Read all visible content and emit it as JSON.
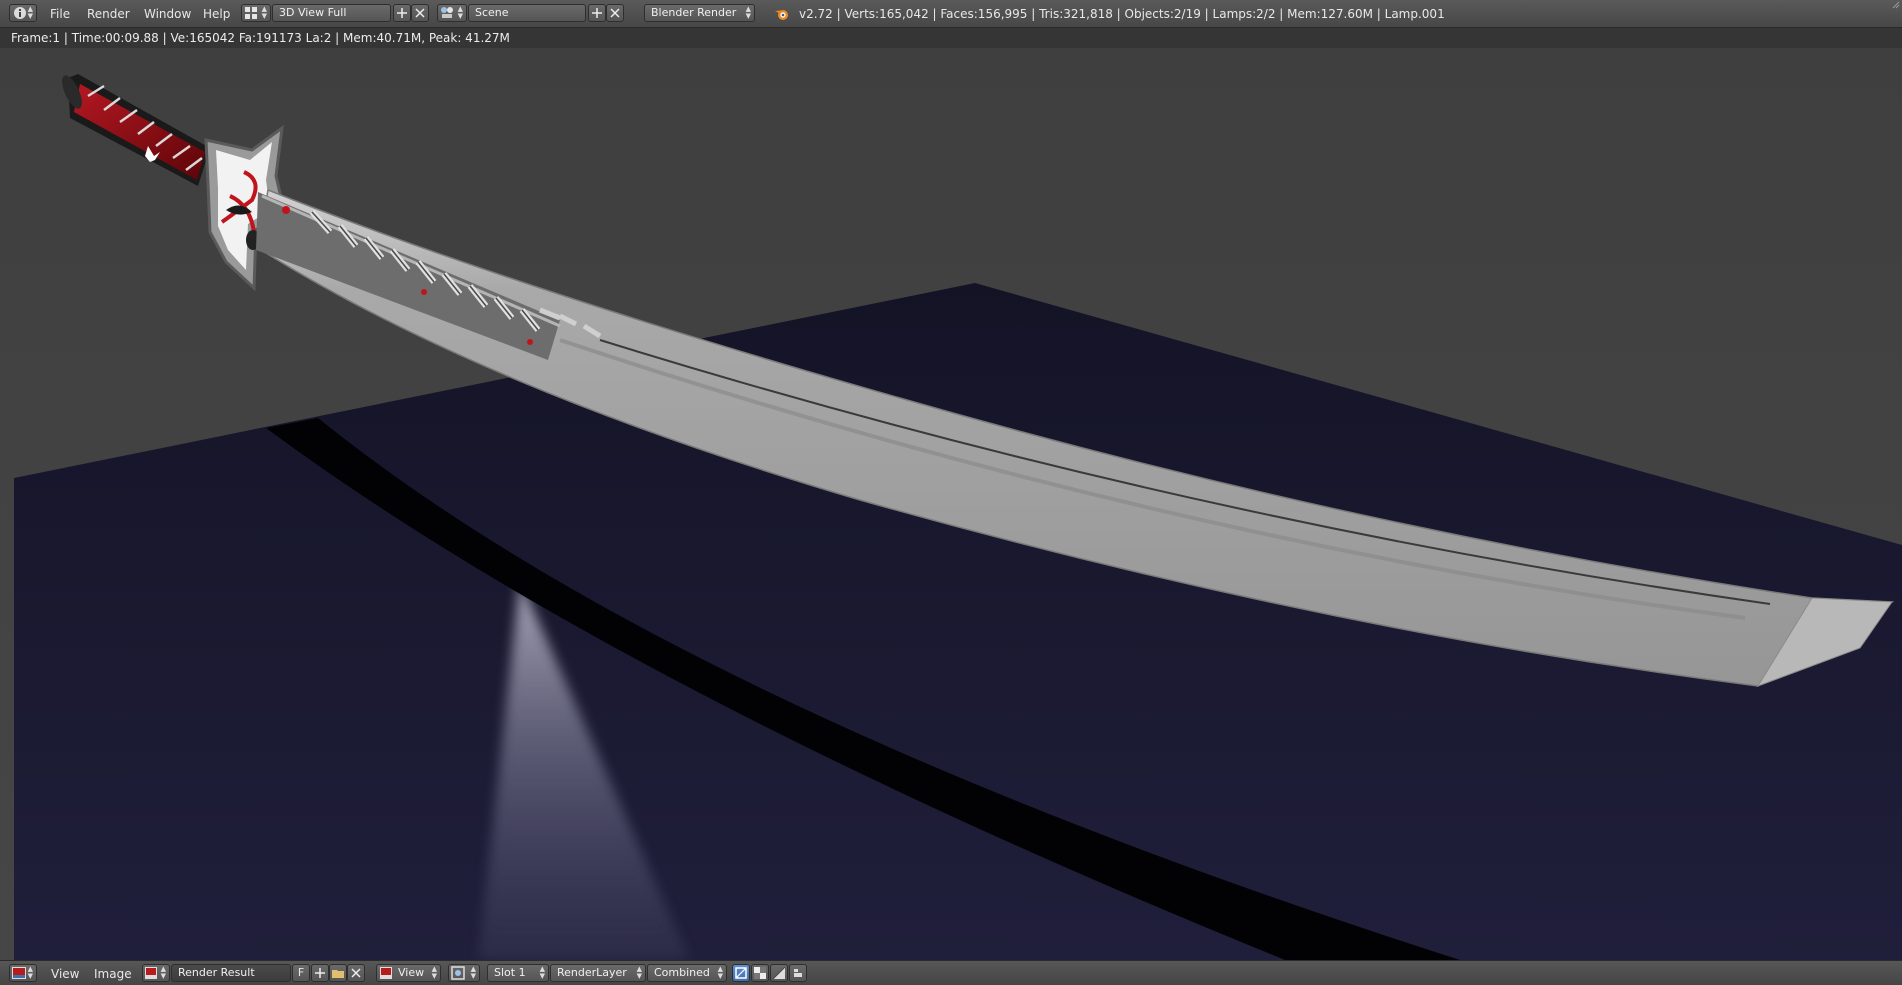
{
  "top_bar": {
    "menus": [
      "File",
      "Render",
      "Window",
      "Help"
    ],
    "screen_layout": "3D View Full",
    "scene": "Scene",
    "render_engine": "Blender Render",
    "stats": "v2.72 | Verts:165,042 | Faces:156,995 | Tris:321,818 | Objects:2/19 | Lamps:2/2 | Mem:127.60M | Lamp.001"
  },
  "image_editor": {
    "info": "Frame:1 | Time:00:09.88 | Ve:165042 Fa:191173 La:2 | Mem:40.71M, Peak: 41.27M"
  },
  "bottom_bar": {
    "menus": [
      "View",
      "Image"
    ],
    "image_name": "Render Result",
    "fake_user": "F",
    "view_label": "View",
    "slot": "Slot 1",
    "render_layer": "RenderLayer",
    "pass": "Combined"
  },
  "icons": {
    "info": "info-icon",
    "layout": "screen-layout-icon",
    "scene": "scene-icon",
    "blender": "blender-logo-icon",
    "editor_type": "image-editor-icon",
    "image": "image-browse-icon",
    "add": "plus-icon",
    "close": "x-icon",
    "open": "folder-icon",
    "view_mode": "view-icon",
    "pin": "pin-icon",
    "alpha": "alpha-checker-icon",
    "z_buffer": "z-buffer-icon",
    "ui": "ui-icon"
  },
  "colors": {
    "header": "#4a4a4a",
    "wall": "#434343",
    "floor": "#1d1c36",
    "blade": "#a8a8a8",
    "handle_wrap": "#8a0a0e"
  }
}
